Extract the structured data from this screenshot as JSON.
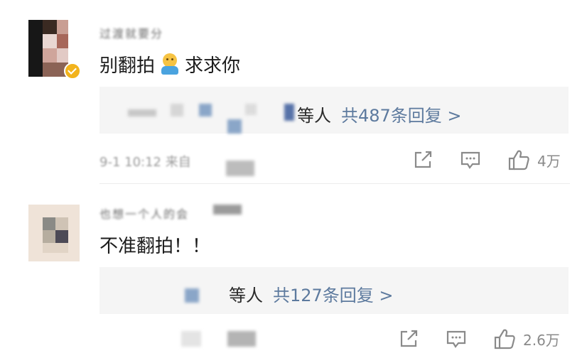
{
  "comments": [
    {
      "username": "过渡就要分",
      "text_before_emoji": "别翻拍",
      "emoji": "person-emoji",
      "text_after_emoji": "求求你",
      "reply_prefix": "等人",
      "reply_count": "共487条回复 >",
      "timestamp": "9-1 10:12 来自",
      "likes": "4万"
    },
    {
      "username": "也想一个人的会",
      "text": "不准翻拍！！",
      "reply_prefix": "等人",
      "reply_count": "共127条回复 >",
      "likes": "2.6万"
    }
  ],
  "icons": [
    "share-icon",
    "comment-icon",
    "like-icon"
  ],
  "colors": {
    "link": "#5d7a9e",
    "reply_bg": "#f5f5f5",
    "meta": "#9a9a9a",
    "verified": "#f2b31c"
  }
}
